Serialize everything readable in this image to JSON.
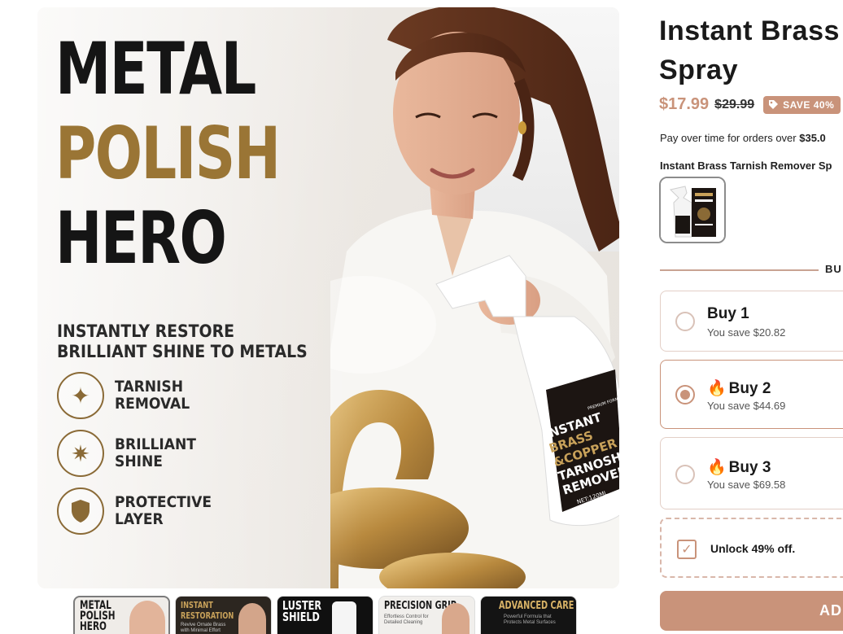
{
  "gallery": {
    "main_image": {
      "headline": [
        "METAL",
        "POLISH",
        "HERO"
      ],
      "tagline": [
        "INSTANTLY RESTORE",
        "BRILLIANT SHINE TO METALS"
      ],
      "features": [
        {
          "icon": "sparkles-icon",
          "label": "TARNISH\nREMOVAL"
        },
        {
          "icon": "star-icon",
          "label": "BRILLIANT\nSHINE"
        },
        {
          "icon": "shield-icon",
          "label": "PROTECTIVE\nLAYER"
        }
      ],
      "bottle_label": [
        "INSTANT",
        "BRASS",
        "&COPPER",
        "TARNOSH",
        "REMOVER"
      ],
      "bottle_badge": "PREMIUM FORMULA",
      "bottle_net": "NET:120ML"
    },
    "thumbnails": [
      {
        "label": "METAL\nPOLISH\nHERO",
        "sub": "",
        "color": "#1a1a1a",
        "bg": "#efece8"
      },
      {
        "label": "INSTANT\nRESTORATION",
        "sub": "Revive Ornate Brass with Minimal Effort",
        "color": "#c9a25a",
        "bg": "#2c2620"
      },
      {
        "label": "LUSTER\nSHIELD",
        "sub": "",
        "color": "#e0b860",
        "bg": "#101010"
      },
      {
        "label": "PRECISION GRIP",
        "sub": "Effortless Control for Detailed Cleaning",
        "color": "#1a1a1a",
        "bg": "#f1efec"
      },
      {
        "label": "ADVANCED CARE",
        "sub": "Powerful Formula that Protects Metal Surfaces",
        "color": "#d8b266",
        "bg": "#141414"
      }
    ]
  },
  "product": {
    "title_lines": [
      "Instant Brass",
      "Spray"
    ],
    "price": "$17.99",
    "compare_price": "$29.99",
    "save_badge": "SAVE 40%",
    "pay_over_prefix": "Pay over time for orders over ",
    "pay_over_amount": "$35.0",
    "variant_title": "Instant Brass Tarnish Remover Sp",
    "bundle_heading": "BU"
  },
  "bundles": [
    {
      "title": "Buy 1",
      "save": "You save $20.82",
      "selected": false,
      "fire": false
    },
    {
      "title": "Buy 2",
      "save": "You save $44.69",
      "selected": true,
      "fire": true
    },
    {
      "title": "Buy 3",
      "save": "You save $69.58",
      "selected": false,
      "fire": true
    }
  ],
  "unlock": {
    "label": "Unlock 49% off.",
    "checked": true
  },
  "add_button": {
    "label": "AD"
  },
  "colors": {
    "accent": "#c9937a",
    "gold": "#9a7535",
    "border": "#e3cfc7"
  }
}
